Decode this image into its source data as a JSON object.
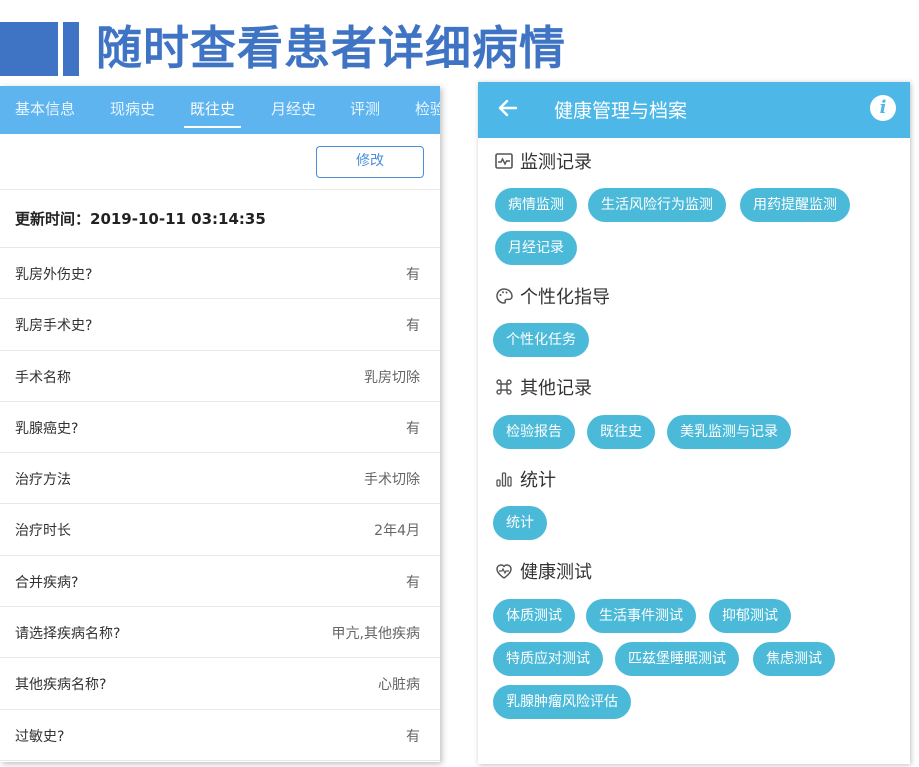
{
  "banner": {
    "title": "随时查看患者详细病情"
  },
  "left": {
    "tabs": [
      {
        "label": "基本信息"
      },
      {
        "label": "现病史"
      },
      {
        "label": "既往史"
      },
      {
        "label": "月经史"
      },
      {
        "label": "评测"
      },
      {
        "label": "检验"
      }
    ],
    "edit_label": "修改",
    "updated": "更新时间：2019-10-11 03:14:35",
    "rows": [
      {
        "label": "乳房外伤史?",
        "value": "有"
      },
      {
        "label": "乳房手术史?",
        "value": "有"
      },
      {
        "label": "手术名称",
        "value": "乳房切除"
      },
      {
        "label": "乳腺癌史?",
        "value": "有"
      },
      {
        "label": "治疗方法",
        "value": "手术切除"
      },
      {
        "label": "治疗时长",
        "value": "2年4月"
      },
      {
        "label": "合并疾病?",
        "value": "有"
      },
      {
        "label": "请选择疾病名称?",
        "value": "甲亢,其他疾病"
      },
      {
        "label": "其他疾病名称?",
        "value": "心脏病"
      },
      {
        "label": "过敏史?",
        "value": "有"
      }
    ]
  },
  "right": {
    "title": "健康管理与档案",
    "sections": [
      {
        "title": "监测记录",
        "icon": "monitor-icon",
        "chips": [
          "病情监测",
          "生活风险行为监测",
          "用药提醒监测",
          "月经记录"
        ]
      },
      {
        "title": "个性化指导",
        "icon": "palette-icon",
        "chips": [
          "个性化任务"
        ]
      },
      {
        "title": "其他记录",
        "icon": "command-icon",
        "chips": [
          "检验报告",
          "既往史",
          "美乳监测与记录"
        ]
      },
      {
        "title": "统计",
        "icon": "bar-chart-icon",
        "chips": [
          "统计"
        ]
      },
      {
        "title": "健康测试",
        "icon": "heart-pulse-icon",
        "chips": [
          "体质测试",
          "生活事件测试",
          "抑郁测试",
          "特质应对测试",
          "匹兹堡睡眠测试",
          "焦虑测试",
          "乳腺肿瘤风险评估"
        ]
      }
    ]
  },
  "colors": {
    "banner": "#3f74c4",
    "tabbar": "#5db4ee",
    "header": "#4db8e8",
    "chip": "#4bbad9"
  }
}
